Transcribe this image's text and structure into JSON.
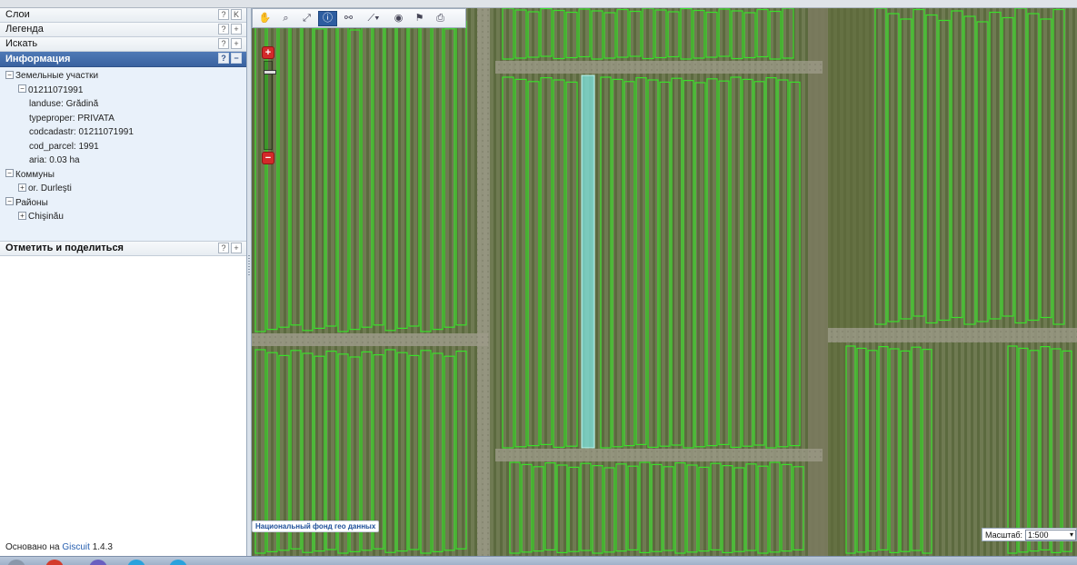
{
  "panel": {
    "layers": {
      "title": "Слои",
      "help": "?",
      "toggle": "K"
    },
    "legend": {
      "title": "Легенда",
      "help": "?",
      "toggle": "+"
    },
    "search": {
      "title": "Искать",
      "help": "?",
      "toggle": "+"
    },
    "info": {
      "title": "Информация",
      "help": "?",
      "toggle": "−",
      "tree": {
        "group1": "Земельные участки",
        "parcel": "01211071991",
        "landuse": "landuse: Grădină",
        "typeproper": "typeproper: PRIVATA",
        "codcadastr": "codcadastr: 01211071991",
        "cod_parcel": "cod_parcel: 1991",
        "aria": "aria: 0.03 ha",
        "group2": "Коммуны",
        "commune": "or. Durleşti",
        "group3": "Районы",
        "district": "Chişinău"
      }
    },
    "share": {
      "title": "Отметить и поделиться",
      "help": "?",
      "toggle": "+"
    },
    "footer": {
      "prefix": "Основано на ",
      "link": "Giscuit",
      "version": " 1.4.3"
    }
  },
  "map": {
    "attribution": "Национальный фонд гео данных",
    "scale_label": "Масштаб:",
    "scale_value": "1:500",
    "zoom_in": "+",
    "zoom_out": "−",
    "zoom_level": 0.1
  },
  "toolbar": {
    "tools": [
      "pan-hand-icon",
      "zoom-box-icon",
      "zoom-extent-icon",
      "identify-icon",
      "find-binoculars-icon",
      "measure-icon",
      "locate-icon",
      "mark-flag-icon",
      "print-icon"
    ],
    "selected": "identify-icon"
  },
  "colors": {
    "parcel_outline": "#3ae02a",
    "parcel_selected": "#7fe6e0",
    "panel_header_active": "#3f6aa8"
  }
}
